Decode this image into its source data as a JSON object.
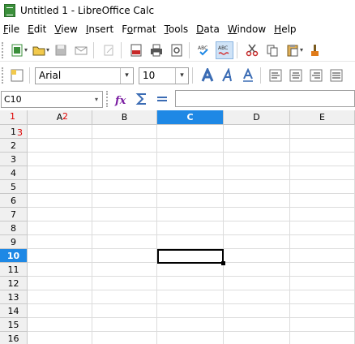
{
  "window": {
    "title": "Untitled 1 - LibreOffice Calc"
  },
  "menu": [
    "File",
    "Edit",
    "View",
    "Insert",
    "Format",
    "Tools",
    "Data",
    "Window",
    "Help"
  ],
  "menu_underline": [
    "F",
    "E",
    "V",
    "I",
    "o",
    "T",
    "D",
    "W",
    "H"
  ],
  "formatting": {
    "font_name": "Arial",
    "font_size": "10"
  },
  "formula_bar": {
    "cell_ref": "C10",
    "value": ""
  },
  "sheet": {
    "columns": [
      "A",
      "B",
      "C",
      "D",
      "E"
    ],
    "rows": [
      "1",
      "2",
      "3",
      "4",
      "5",
      "6",
      "7",
      "8",
      "9",
      "10",
      "11",
      "12",
      "13",
      "14",
      "15",
      "16"
    ],
    "selected_column": "C",
    "selected_row": "10"
  },
  "annotations": {
    "m1": "1",
    "m2": "2",
    "m3": "3"
  },
  "colors": {
    "accent": "#1e88e5"
  }
}
